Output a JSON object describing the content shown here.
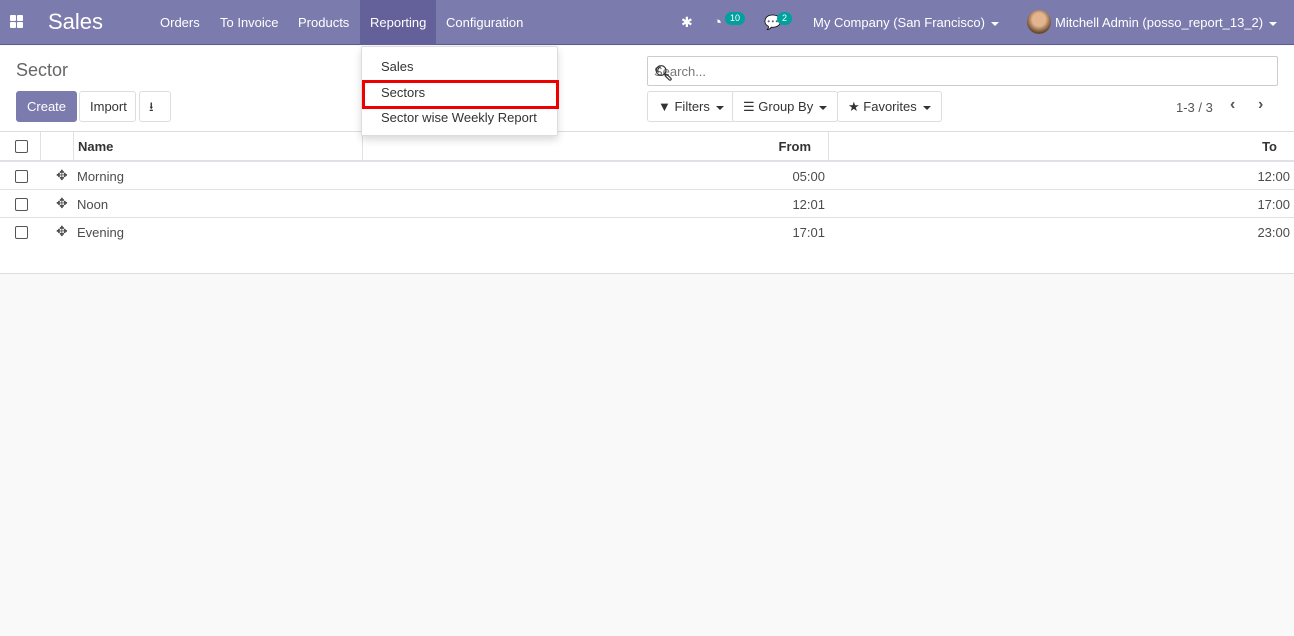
{
  "navbar": {
    "app_title": "Sales",
    "menus": [
      "Orders",
      "To Invoice",
      "Products",
      "Reporting",
      "Configuration"
    ],
    "activity_count": "10",
    "message_count": "2",
    "company": "My Company (San Francisco)",
    "user": "Mitchell Admin (posso_report_13_2)"
  },
  "reporting_dropdown": {
    "items": [
      "Sales",
      "Sectors",
      "Sector wise Weekly Report"
    ],
    "highlighted": "Sectors"
  },
  "control_panel": {
    "title": "Sector",
    "create": "Create",
    "import": "Import",
    "search_placeholder": "Search...",
    "filters": "Filters",
    "group_by": "Group By",
    "favorites": "Favorites",
    "pager": "1-3 / 3"
  },
  "table": {
    "headers": {
      "name": "Name",
      "from": "From",
      "to": "To"
    },
    "rows": [
      {
        "name": "Morning",
        "from": "05:00",
        "to": "12:00"
      },
      {
        "name": "Noon",
        "from": "12:01",
        "to": "17:00"
      },
      {
        "name": "Evening",
        "from": "17:01",
        "to": "23:00"
      }
    ]
  }
}
